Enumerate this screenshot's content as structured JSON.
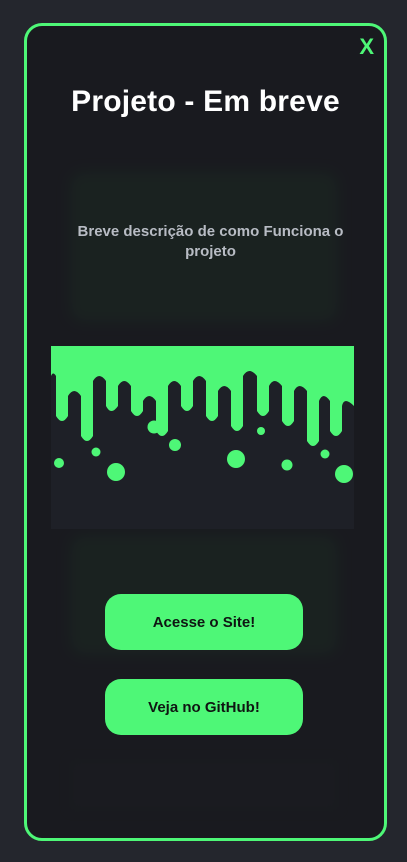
{
  "modal": {
    "close_label": "X",
    "title": "Projeto - Em breve",
    "description": "Breve descrição de como Funciona o projeto",
    "image_icon": "green-drip-illustration",
    "buttons": {
      "site": "Acesse o Site!",
      "github": "Veja no GitHub!"
    }
  },
  "colors": {
    "accent": "#4ef777",
    "background": "#24262d",
    "modal_bg": "#16181c",
    "image_bg": "#1e2027"
  }
}
